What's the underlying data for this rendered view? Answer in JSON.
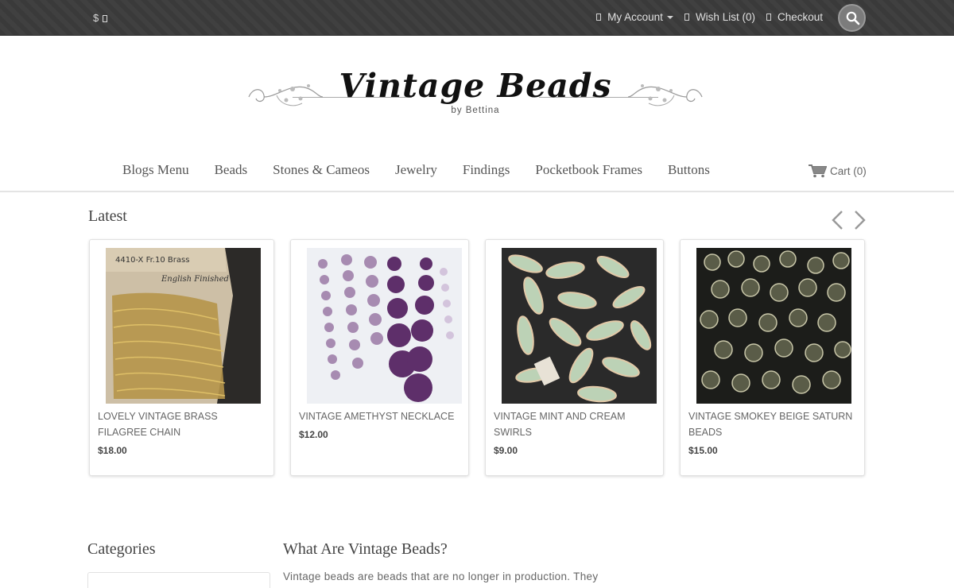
{
  "topbar": {
    "currency": "$",
    "links": {
      "account": "My Account",
      "wishlist": "Wish List (0)",
      "checkout": "Checkout"
    }
  },
  "logo": {
    "title": "Vintage Beads",
    "subtitle": "by Bettina"
  },
  "nav": {
    "items": [
      "Blogs Menu",
      "Beads",
      "Stones & Cameos",
      "Jewelry",
      "Findings",
      "Pocketbook Frames",
      "Buttons"
    ],
    "cart": "Cart (0)"
  },
  "latest": {
    "title": "Latest",
    "products": [
      {
        "name": "LOVELY VINTAGE BRASS FILAGREE CHAIN",
        "price": "$18.00"
      },
      {
        "name": "VINTAGE AMETHYST NECKLACE",
        "price": "$12.00"
      },
      {
        "name": "VINTAGE MINT AND CREAM SWIRLS",
        "price": "$9.00"
      },
      {
        "name": "VINTAGE SMOKEY BEIGE SATURN BEADS",
        "price": "$15.00"
      }
    ]
  },
  "sidebar": {
    "title": "Categories"
  },
  "content": {
    "title": "What Are Vintage Beads?",
    "text": "Vintage beads are beads that are no longer in production. They"
  }
}
